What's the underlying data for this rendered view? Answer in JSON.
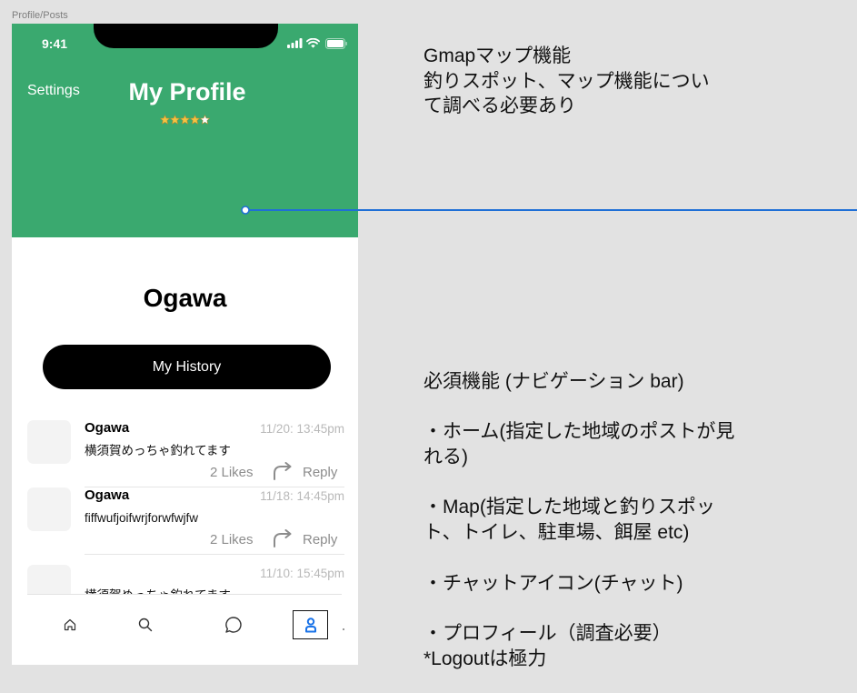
{
  "canvas": {
    "frame_label": "Profile/Posts"
  },
  "colors": {
    "canvas": "#e2e2e2",
    "header": "#3aa96f",
    "star_filled": "#f5c342",
    "star_empty": "#ffffff",
    "connector": "#1f6fd6",
    "nav_active": "#1a73e8",
    "button": "#000000"
  },
  "phone": {
    "status_bar": {
      "time": "9:41",
      "icons": [
        "signal-icon",
        "wifi-icon",
        "battery-icon"
      ]
    },
    "header": {
      "settings_label": "Settings",
      "title": "My Profile",
      "rating": {
        "value": 4,
        "max": 5
      }
    },
    "profile": {
      "name": "Ogawa",
      "history_button": "My History"
    },
    "posts": [
      {
        "author": "Ogawa",
        "time": "11/20: 13:45pm",
        "text": "横須賀めっちゃ釣れてます",
        "likes": "2 Likes",
        "reply": "Reply",
        "reply_icon": "reply-icon"
      },
      {
        "author": "Ogawa",
        "time": "11/18: 14:45pm",
        "text": "fiffwufjoifwrjforwfwjfw",
        "likes": "2 Likes",
        "reply": "Reply",
        "reply_icon": "reply-icon"
      },
      {
        "time": "11/10: 15:45pm",
        "text": "横須賀めっちゃ釣れてます"
      }
    ],
    "nav": {
      "items": [
        {
          "icon": "home-icon",
          "active": false
        },
        {
          "icon": "search-icon",
          "active": false
        },
        {
          "icon": "chat-icon",
          "active": false
        },
        {
          "icon": "profile-icon",
          "active": true
        }
      ]
    }
  },
  "notes": {
    "gmap": [
      "Gmapマップ機能",
      "釣りスポット、マップ機能につい",
      "て調べる必要あり"
    ],
    "requirements": {
      "heading": "必須機能 (ナビゲーション bar)",
      "items": [
        [
          "・ホーム(指定した地域のポストが見",
          "れる)"
        ],
        [
          "・Map(指定した地域と釣りスポッ",
          "ト、トイレ、駐車場、餌屋 etc)"
        ],
        [
          "・チャットアイコン(チャット)"
        ],
        [
          "・プロフィール（調査必要）",
          "*Logoutは極力"
        ]
      ]
    }
  }
}
